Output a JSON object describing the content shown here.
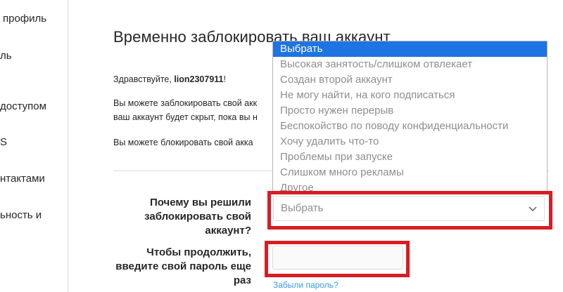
{
  "sidebar": {
    "items": [
      {
        "label": "профиль"
      },
      {
        "label": "ль"
      },
      {
        "label": "доступом"
      },
      {
        "label": "S"
      },
      {
        "label": "нтактами"
      },
      {
        "label": "ьность и"
      }
    ]
  },
  "page": {
    "title": "Временно заблокировать ваш аккаунт",
    "greeting_prefix": "Здравствуйте, ",
    "username": "lion2307911",
    "greeting_suffix": "!",
    "paragraph1_line1": "Вы можете заблокировать свой акк",
    "paragraph1_line2": "ваш аккаунт будет скрыт, пока вы н",
    "paragraph2": "Вы можете блокировать свой акка"
  },
  "reason": {
    "label": "Почему вы решили заблокировать свой аккаунт?",
    "selected_value": "Выбрать",
    "options": [
      "Выбрать",
      "Высокая занятость/слишком отвлекает",
      "Создан второй аккаунт",
      "Не могу найти, на кого подписаться",
      "Просто нужен перерыв",
      "Беспокойство по поводу конфиденциальности",
      "Хочу удалить что-то",
      "Проблемы при запуске",
      "Слишком много рекламы",
      "Другое"
    ]
  },
  "password": {
    "label": "Чтобы продолжить, введите свой пароль еще раз",
    "value": "",
    "forgot_link": "Забыли пароль?"
  },
  "colors": {
    "highlight": "#d71d24",
    "selected_option": "#1e74e3",
    "link": "#3897f0"
  }
}
